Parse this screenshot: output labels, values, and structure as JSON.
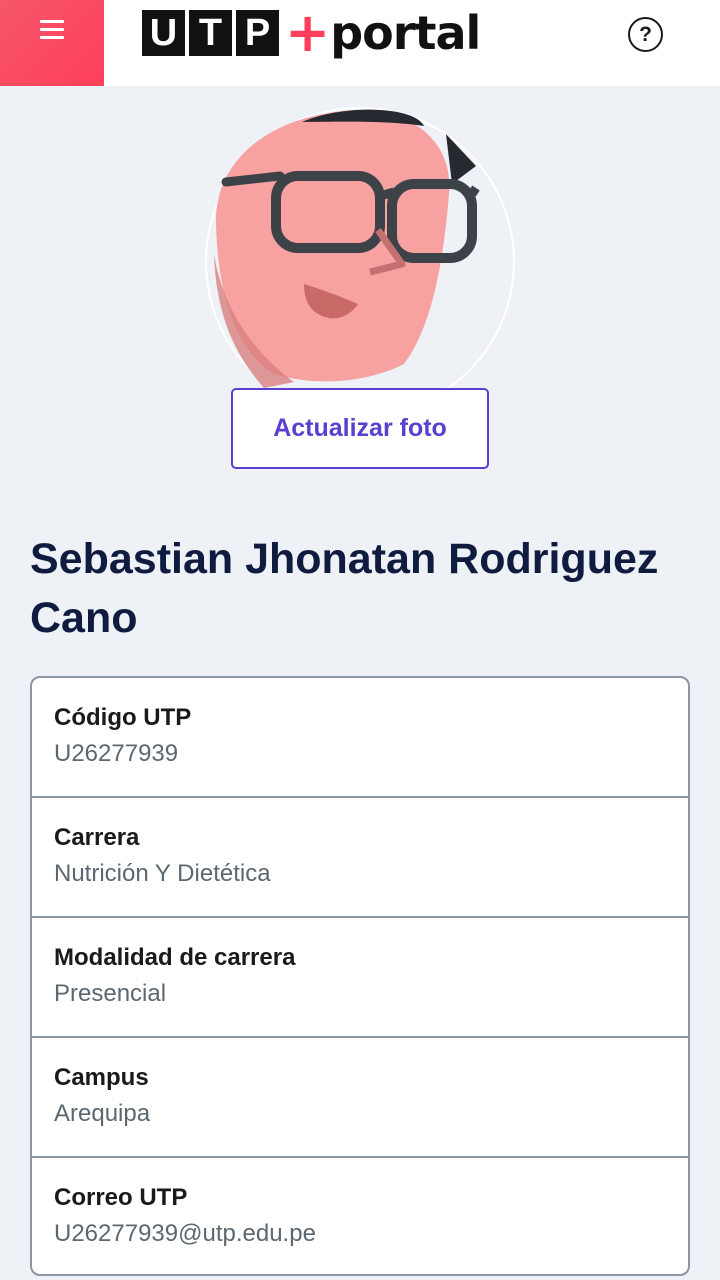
{
  "header": {
    "logo_letters": [
      "U",
      "T",
      "P"
    ],
    "logo_plus": "+",
    "logo_word": "portal",
    "help_label": "?",
    "brand_color": "#ff3f5c"
  },
  "profile": {
    "update_photo_label": "Actualizar foto",
    "name": "Sebastian Jhonatan Rodriguez Cano"
  },
  "info": [
    {
      "label": "Código UTP",
      "value": "U26277939"
    },
    {
      "label": "Carrera",
      "value": "Nutrición Y Dietética"
    },
    {
      "label": "Modalidad de carrera",
      "value": "Presencial"
    },
    {
      "label": "Campus",
      "value": "Arequipa"
    },
    {
      "label": "Correo UTP",
      "value": "U26277939@utp.edu.pe"
    }
  ]
}
